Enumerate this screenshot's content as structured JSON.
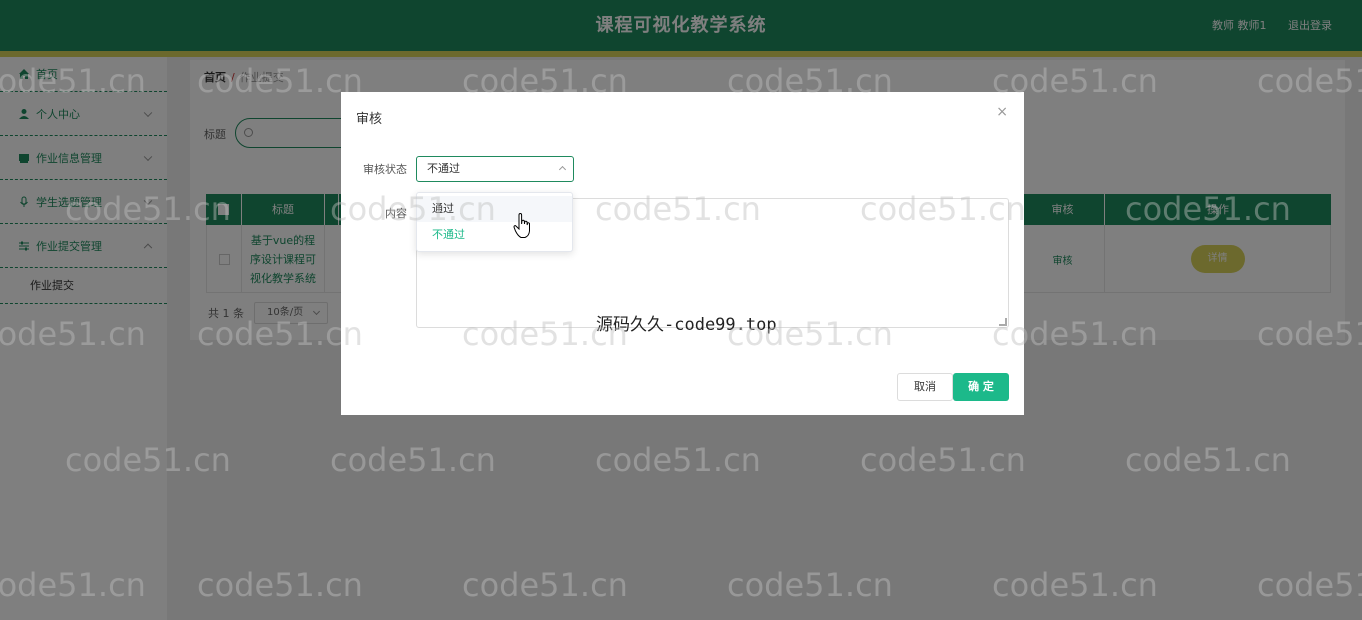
{
  "header": {
    "title": "课程可视化教学系统",
    "user": "教师 教师1",
    "logout": "退出登录"
  },
  "sidebar": {
    "items": [
      {
        "label": "首页",
        "icon": "home-icon"
      },
      {
        "label": "个人中心",
        "icon": "user-icon"
      },
      {
        "label": "作业信息管理",
        "icon": "book-icon"
      },
      {
        "label": "学生选题管理",
        "icon": "mic-icon"
      },
      {
        "label": "作业提交管理",
        "icon": "sliders-icon"
      }
    ],
    "sub_item": "作业提交"
  },
  "breadcrumb": {
    "home": "首页",
    "sep": "/",
    "current": "作业提交"
  },
  "search": {
    "label": "标题"
  },
  "table": {
    "headers": [
      "标题",
      "审核",
      "操作"
    ],
    "row": {
      "title": "基于vue的程序设计课程可视化教学系统",
      "audit": "审核",
      "detail": "详情"
    }
  },
  "pager": {
    "total": "共 1 条",
    "page_size": "10条/页"
  },
  "modal": {
    "title": "审核",
    "close": "×",
    "status_label": "审核状态",
    "status_value": "不通过",
    "content_label": "内容",
    "cancel": "取消",
    "ok": "确 定"
  },
  "dropdown": {
    "options": [
      "通过",
      "不通过"
    ],
    "selected": "不通过",
    "hovered": "通过"
  },
  "overlay_text": "源码久久-code99.top",
  "watermark": "code51.cn",
  "colors": {
    "primary": "#1f8a5e",
    "accent": "#d8d35a",
    "ok_button": "#1cb98a"
  }
}
